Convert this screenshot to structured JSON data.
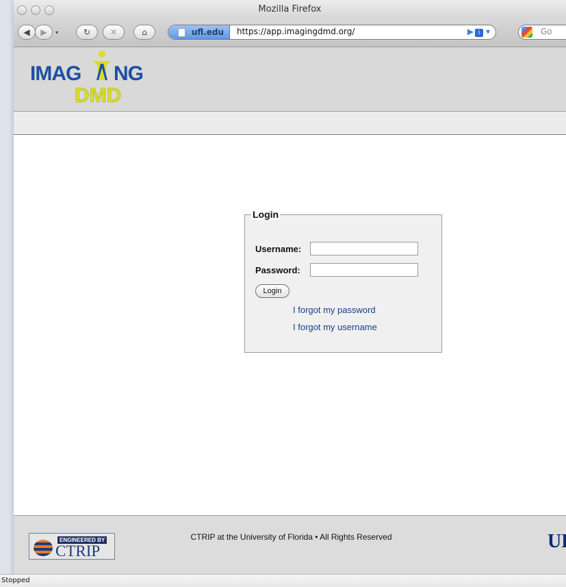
{
  "window": {
    "title": "Mozilla Firefox"
  },
  "toolbar": {
    "site_identity": "ufl.edu",
    "url": "https://app.imagingdmd.org/",
    "search_placeholder": "Go"
  },
  "header": {
    "logo_text_top": "IMAGING",
    "logo_text_bottom": "DMD",
    "colors": {
      "logo_blue": "#1d4fa5",
      "logo_yellow": "#d8dd2a"
    }
  },
  "login": {
    "legend": "Login",
    "username_label": "Username:",
    "password_label": "Password:",
    "username_value": "",
    "password_value": "",
    "submit_label": "Login",
    "forgot_password": "I forgot my password",
    "forgot_username": "I forgot my username"
  },
  "footer": {
    "engineered_by": "ENGINEERED BY",
    "ctrip": "CTRIP",
    "copyright": "CTRIP at the University of Florida • All Rights Reserved",
    "uf": "UF"
  },
  "status": {
    "text": "Stopped"
  }
}
